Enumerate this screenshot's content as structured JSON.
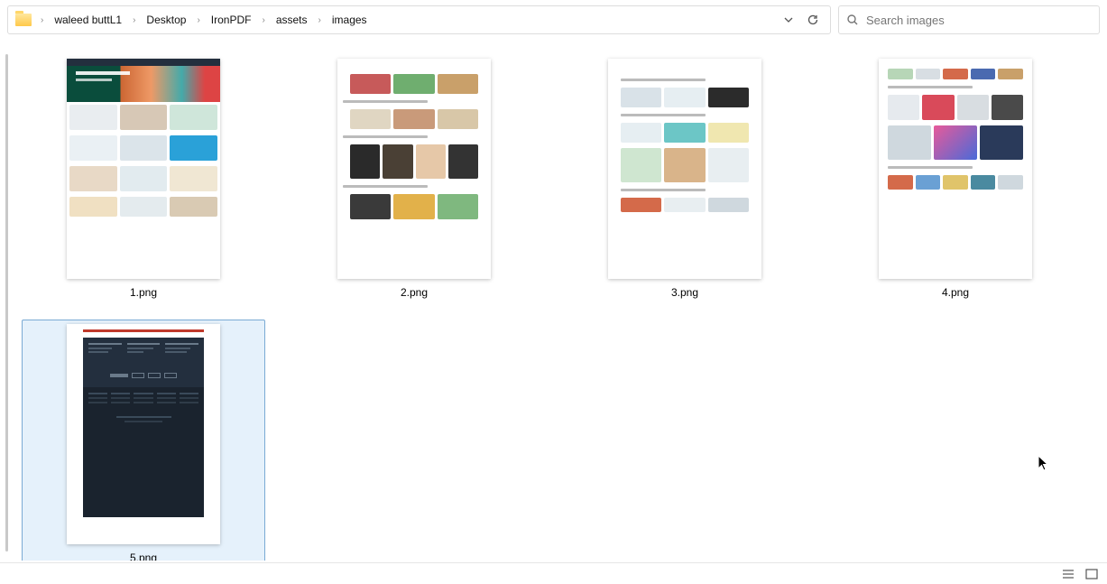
{
  "breadcrumb": {
    "segments": [
      "waleed buttL1",
      "Desktop",
      "IronPDF",
      "assets",
      "images"
    ]
  },
  "search": {
    "placeholder": "Search images"
  },
  "files": [
    {
      "name": "1.png",
      "selected": false
    },
    {
      "name": "2.png",
      "selected": false
    },
    {
      "name": "3.png",
      "selected": false
    },
    {
      "name": "4.png",
      "selected": false
    },
    {
      "name": "5.png",
      "selected": true
    }
  ],
  "icons": {
    "chevron": "›",
    "dropdown": "⌄"
  }
}
